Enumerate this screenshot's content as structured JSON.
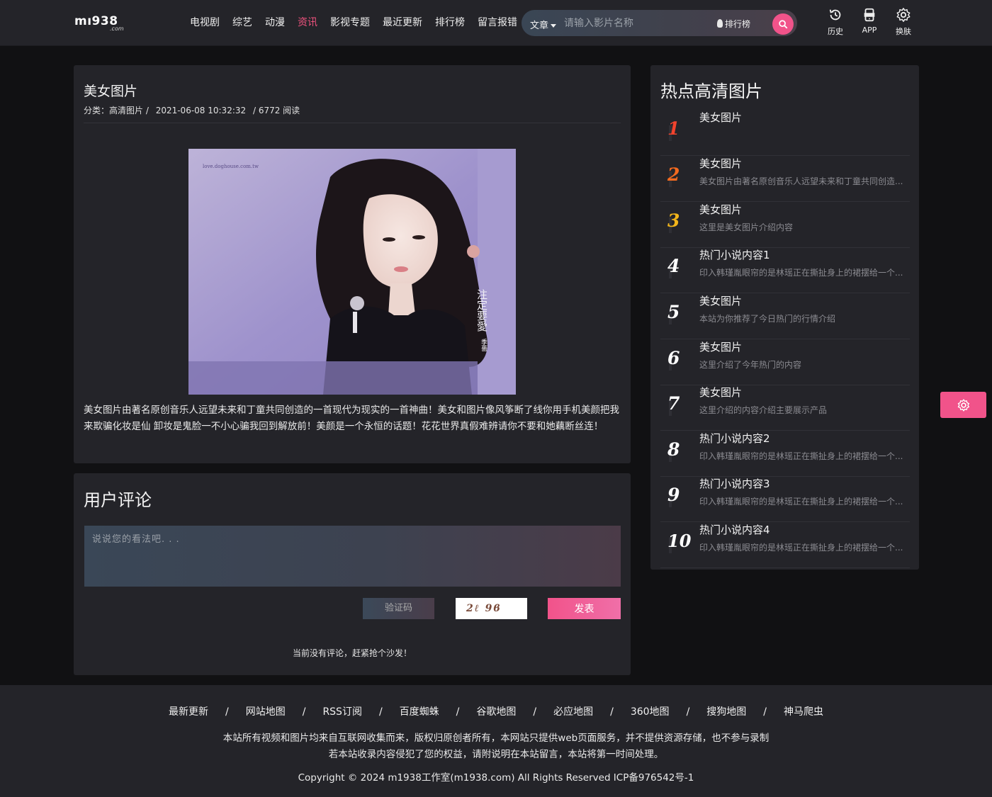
{
  "header": {
    "logo_main": "mı938",
    "logo_sub": ".com",
    "nav": [
      {
        "label": "电视剧",
        "active": false
      },
      {
        "label": "综艺",
        "active": false
      },
      {
        "label": "动漫",
        "active": false
      },
      {
        "label": "资讯",
        "active": true
      },
      {
        "label": "影视专题",
        "active": false
      },
      {
        "label": "最近更新",
        "active": false
      },
      {
        "label": "排行榜",
        "active": false
      },
      {
        "label": "留言报错",
        "active": false
      }
    ],
    "search": {
      "type_label": "文章",
      "placeholder": "请输入影片名称",
      "rank_label": "排行榜"
    },
    "tools": [
      {
        "label": "历史",
        "icon": "history-icon"
      },
      {
        "label": "APP",
        "icon": "app-icon"
      },
      {
        "label": "换肤",
        "icon": "skin-icon"
      }
    ],
    "accent": "#f1538a"
  },
  "article": {
    "title": "美女图片",
    "category": "分类：高清图片 /",
    "date": "2021-06-08 10:32:32",
    "views": "/ 6772 阅读",
    "image_watermark": "love.doghouse.com.tw",
    "image_side_text": "注定要愛",
    "image_author": "季薔",
    "body": "美女图片由著名原创音乐人远望未来和丁童共同创造的一首现代为现实的一首神曲！美女和图片像风筝断了线你用手机美颜把我来欺骗化妆是仙 卸妆是鬼脸一不小心骗我回到解放前！美颜是一个永恒的话题！花花世界真假难辨请你不要和她藕断丝连！"
  },
  "comments": {
    "title": "用户评论",
    "placeholder": "说说您的看法吧. . .",
    "captcha_placeholder": "验证码",
    "captcha_text": "2ℓ 9ϐ",
    "submit_label": "发表",
    "empty_text": "当前没有评论，赶紧抢个沙发！"
  },
  "hot": {
    "title": "热点高清图片",
    "items": [
      {
        "rank": "1",
        "color": "#f1432d",
        "title": "美女图片",
        "desc": ""
      },
      {
        "rank": "2",
        "color": "#f46a1f",
        "title": "美女图片",
        "desc": "美女图片由著名原创音乐人远望未来和丁童共同创造..."
      },
      {
        "rank": "3",
        "color": "#f2b51b",
        "title": "美女图片",
        "desc": "这里是美女图片介绍内容"
      },
      {
        "rank": "4",
        "color": "#ffffff",
        "title": "热门小说内容1",
        "desc": "印入韩瑾胤眼帘的是林瑶正在撕扯身上的裙摆给一个..."
      },
      {
        "rank": "5",
        "color": "#ffffff",
        "title": "美女图片",
        "desc": "本站为你推荐了今日热门的行情介绍"
      },
      {
        "rank": "6",
        "color": "#ffffff",
        "title": "美女图片",
        "desc": "这里介绍了今年热门的内容"
      },
      {
        "rank": "7",
        "color": "#ffffff",
        "title": "美女图片",
        "desc": "这里介绍的内容介绍主要展示产品"
      },
      {
        "rank": "8",
        "color": "#ffffff",
        "title": "热门小说内容2",
        "desc": "印入韩瑾胤眼帘的是林瑶正在撕扯身上的裙摆给一个..."
      },
      {
        "rank": "9",
        "color": "#ffffff",
        "title": "热门小说内容3",
        "desc": "印入韩瑾胤眼帘的是林瑶正在撕扯身上的裙摆给一个..."
      },
      {
        "rank": "10",
        "color": "#ffffff",
        "title": "热门小说内容4",
        "desc": "印入韩瑾胤眼帘的是林瑶正在撕扯身上的裙摆给一个..."
      }
    ]
  },
  "footer": {
    "links": [
      "最新更新",
      "网站地图",
      "RSS订阅",
      "百度蜘蛛",
      "谷歌地图",
      "必应地图",
      "360地图",
      "搜狗地图",
      "神马爬虫"
    ],
    "separator": "/",
    "note1": "本站所有视频和图片均来自互联网收集而来，版权归原创者所有，本网站只提供web页面服务，并不提供资源存储，也不参与录制",
    "note2": "若本站收录内容侵犯了您的权益，请附说明在本站留言，本站将第一时间处理。",
    "copyright": "Copyright © 2024 m1938工作室(m1938.com) All Rights Reserved ICP备976542号-1"
  }
}
